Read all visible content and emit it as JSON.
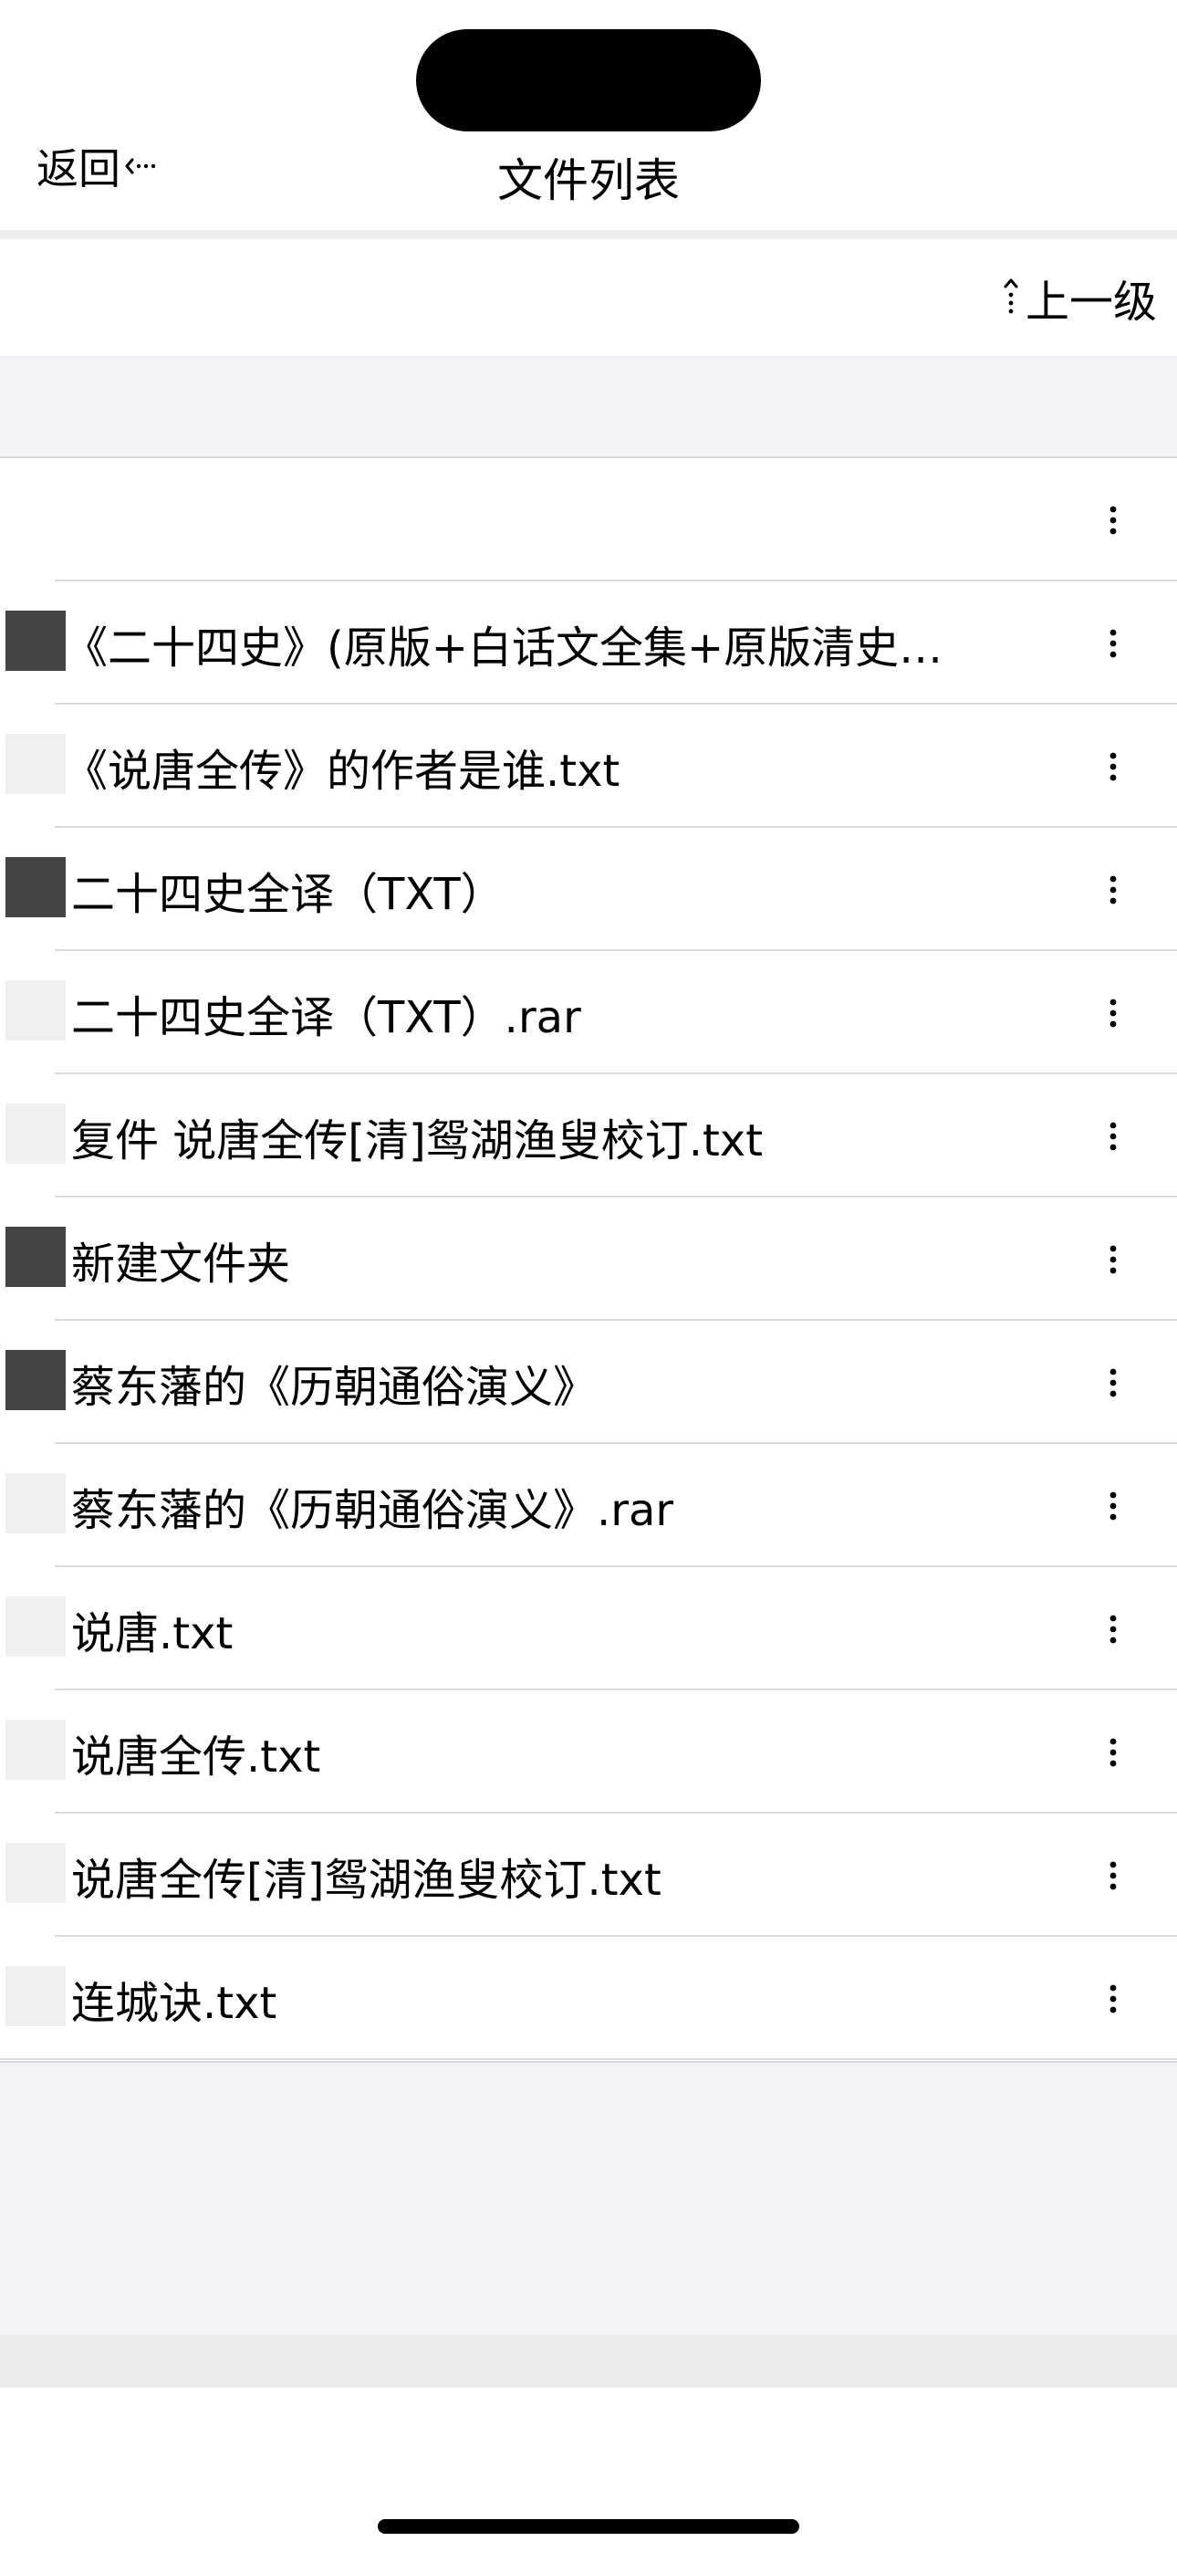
{
  "nav": {
    "back_label": "返回",
    "title": "文件列表"
  },
  "toolbar": {
    "up_level_label": "上一级"
  },
  "icons": {
    "back": "back-arrow-icon",
    "up": "up-arrow-icon",
    "more": "more-vertical-icon"
  },
  "colors": {
    "folder_thumb": "#444444",
    "file_thumb": "#efefef",
    "gray_band": "#f2f2f7"
  },
  "files": [
    {
      "name": "",
      "type": "none"
    },
    {
      "name": "《二十四史》(原版+白话文全集+原版清史…",
      "type": "folder"
    },
    {
      "name": "《说唐全传》的作者是谁.txt",
      "type": "file"
    },
    {
      "name": "二十四史全译（TXT）",
      "type": "folder"
    },
    {
      "name": "二十四史全译（TXT）.rar",
      "type": "file"
    },
    {
      "name": "复件 说唐全传[清]鸳湖渔叟校订.txt",
      "type": "file"
    },
    {
      "name": "新建文件夹",
      "type": "folder"
    },
    {
      "name": "蔡东藩的《历朝通俗演义》",
      "type": "folder"
    },
    {
      "name": "蔡东藩的《历朝通俗演义》.rar",
      "type": "file"
    },
    {
      "name": "说唐.txt",
      "type": "file"
    },
    {
      "name": "说唐全传.txt",
      "type": "file"
    },
    {
      "name": "说唐全传[清]鸳湖渔叟校订.txt",
      "type": "file"
    },
    {
      "name": "连城诀.txt",
      "type": "file"
    }
  ]
}
